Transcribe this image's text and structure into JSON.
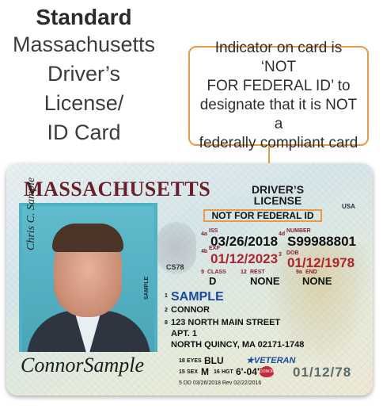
{
  "heading": {
    "line1": "Standard",
    "line2": "Massachusetts",
    "line3": "Driver’s License/",
    "line4": "ID Card"
  },
  "callout": {
    "line1": "Indicator on card is ‘NOT",
    "line2": "FOR FEDERAL ID’ to",
    "line3": "designate that it is NOT a",
    "line4": "federally compliant card"
  },
  "colors": {
    "callout_border": "#e89a45",
    "state_name": "#6b1e2b",
    "label_red": "#8a1f2c",
    "name_blue": "#1b4aa0"
  },
  "card": {
    "state": "MASSACHUSETTS",
    "doc_title_1": "DRIVER’S",
    "doc_title_2": "LICENSE",
    "federal_indicator": "NOT FOR FEDERAL ID",
    "country": "USA",
    "photo_side_text": "SAMPLE",
    "photo_signature": "Chris C. Sample",
    "ghost_code": "CS78",
    "fields": {
      "iss_num": "4a",
      "iss_label": "ISS",
      "iss_value": "03/26/2018",
      "exp_num": "4b",
      "exp_label": "EXP",
      "exp_value": "01/12/2023",
      "number_num": "4d",
      "number_label": "NUMBER",
      "number_value": "S99988801",
      "dob_num": "3",
      "dob_label": "DOB",
      "dob_value": "01/12/1978",
      "class_num": "9",
      "class_label": "CLASS",
      "class_value": "D",
      "rest_num": "12",
      "rest_label": "REST",
      "rest_value": "NONE",
      "end_num": "9a",
      "end_label": "END",
      "end_value": "NONE"
    },
    "name": {
      "num1": "1",
      "last": "SAMPLE",
      "num2": "2",
      "first": "CONNOR"
    },
    "address": {
      "num": "8",
      "line1": "123 NORTH MAIN STREET",
      "line2": "APT. 1",
      "line3": "NORTH QUINCY, MA 02171-1748"
    },
    "eyes": {
      "num": "18",
      "label": "EYES",
      "value": "BLU"
    },
    "veteran": "★VETERAN",
    "sex": {
      "num": "15",
      "label": "SEX",
      "value": "M"
    },
    "hgt": {
      "num": "16",
      "label": "HGT",
      "value": "6'-04\""
    },
    "donor": "DONOR",
    "dd_line": "5 DD 03/26/2018 Rev 02/22/2016",
    "signature": "ConnorSample",
    "ghost_dob": "01/12/78"
  }
}
